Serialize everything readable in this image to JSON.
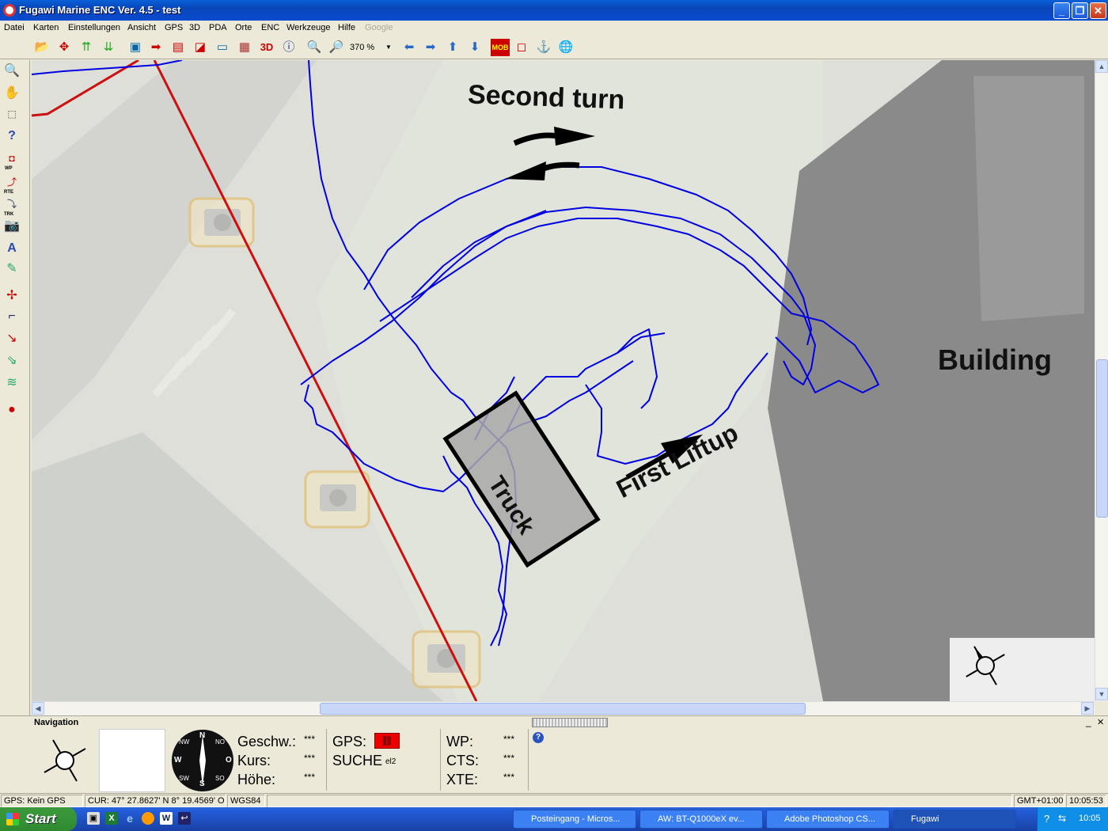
{
  "window": {
    "title": "Fugawi Marine ENC Ver. 4.5 - test",
    "min": "_",
    "max": "❐",
    "close": "✕"
  },
  "menu": [
    "Datei",
    "Karten",
    "Einstellungen",
    "Ansicht",
    "GPS",
    "3D",
    "PDA",
    "Orte",
    "ENC",
    "Werkzeuge",
    "Hilfe",
    "Google"
  ],
  "toolbar": {
    "zoom_level": "370 %",
    "mob_label": "MOB",
    "three_d_label": "3D"
  },
  "left_tools": {
    "wp": "WP",
    "rte": "RTE",
    "trk": "TRK"
  },
  "map": {
    "annotations": {
      "second_turn": "Second turn",
      "first_liftup": "First Liftup",
      "truck": "Truck",
      "building": "Building"
    },
    "track_color": "#0000e0",
    "route_color": "#cc1010"
  },
  "navigation": {
    "title": "Navigation",
    "speed_label": "Geschw.:",
    "speed_value": "***",
    "course_label": "Kurs:",
    "course_value": "***",
    "height_label": "Höhe:",
    "height_value": "***",
    "gps_label": "GPS:",
    "search_label": "SUCHE",
    "search_suffix": "el2",
    "wp_label": "WP:",
    "wp_value": "***",
    "cts_label": "CTS:",
    "cts_value": "***",
    "xte_label": "XTE:",
    "xte_value": "***",
    "compass": {
      "n": "N",
      "s": "S",
      "e": "O",
      "w": "W",
      "ne": "NO",
      "nw": "NW",
      "se": "SO",
      "sw": "SW"
    }
  },
  "status": {
    "gps": "GPS: Kein GPS",
    "cursor": "CUR: 47° 27.8627' N 8° 19.4569' O",
    "datum": "WGS84",
    "timezone": "GMT+01:00",
    "time": "10:05:53"
  },
  "taskbar": {
    "start": "Start",
    "tasks": [
      "Posteingang - Micros...",
      "AW: BT-Q1000eX ev...",
      "Adobe Photoshop CS...",
      "Fugawi"
    ],
    "clock": "10:05"
  }
}
